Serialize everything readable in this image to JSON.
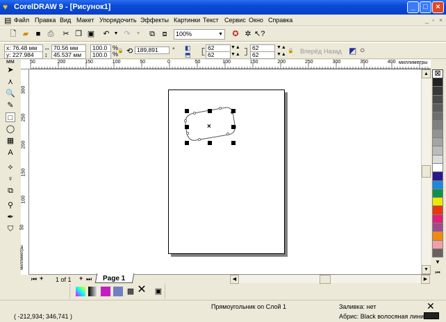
{
  "window": {
    "title": "CorelDRAW 9 - [Рисунок1]"
  },
  "menu": [
    "Файл",
    "Правка",
    "Вид",
    "Макет",
    "Упорядочить",
    "Эффекты",
    "Картинки",
    "Текст",
    "Сервис",
    "Окно",
    "Справка"
  ],
  "toolbar": {
    "zoom": "100%"
  },
  "props": {
    "x": "x: 76.48 мм",
    "y": "y: 227.984 мм",
    "w": "70.56 мм",
    "h": "45.537 мм",
    "sx": "100.0",
    "sy": "100.0",
    "pct": "%",
    "angle": "189,891",
    "deg": "°",
    "r1": "62",
    "r2": "62",
    "r3": "62",
    "r4": "62",
    "forward": "Вперёд",
    "back": "Назад"
  },
  "ruler": {
    "h_labels": [
      "50",
      "200",
      "150",
      "100",
      "50",
      "0",
      "50",
      "100",
      "150",
      "200",
      "250",
      "300",
      "350",
      "400"
    ],
    "h_unit": "миллиметры",
    "v_labels": [
      "300",
      "250",
      "200",
      "150",
      "100",
      "50"
    ],
    "v_unit": "миллиметры"
  },
  "pages": {
    "counter": "1 of 1",
    "tab": "Page 1"
  },
  "palette": [
    "#222222",
    "#383838",
    "#4a4a4a",
    "#5c5c5c",
    "#6e6e6e",
    "#808080",
    "#929292",
    "#a4a4a4",
    "#bcbcbc",
    "#dcdcdc",
    "#ffffff",
    "#2a1888",
    "#1a8ae0",
    "#10904a",
    "#f0e800",
    "#e83810",
    "#e0207a",
    "#a04a8a",
    "#f08a10",
    "#f0a0a8",
    "#6a6060"
  ],
  "status": {
    "coords": "( -212,934; 346,741 )",
    "object": "Прямоугольник on Слой 1",
    "fill": "Заливка: нет",
    "outline": "Абрис: Black  волосяная линия",
    "outline_color": "#222222"
  }
}
